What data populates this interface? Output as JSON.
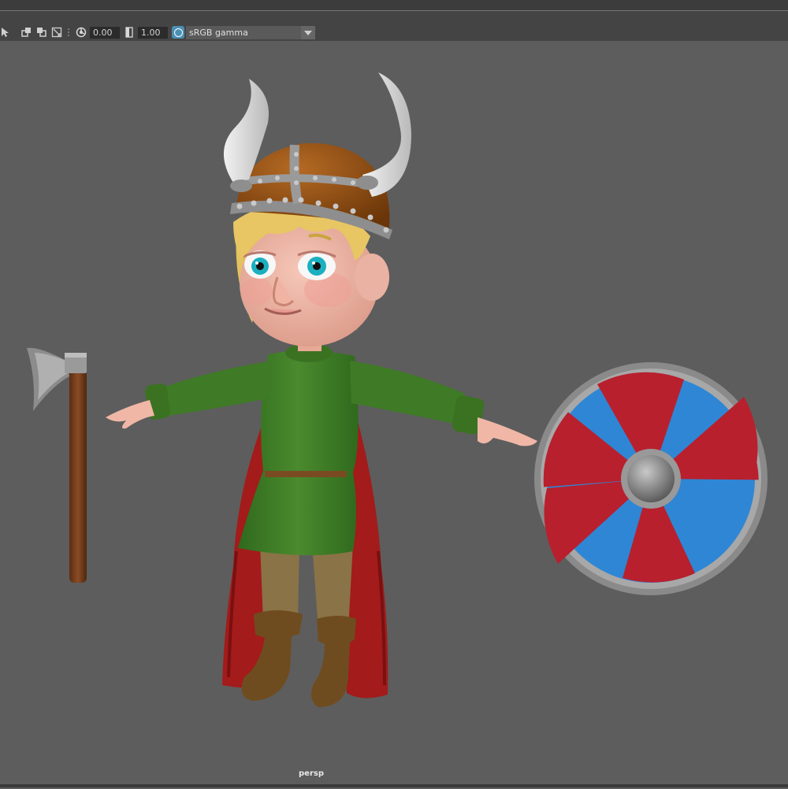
{
  "toolbar": {
    "exposure_value": "0.00",
    "gamma_value": "1.00",
    "view_transform": "sRGB gamma",
    "icons": [
      "select-camera-icon",
      "isolate-icon",
      "xray-icon",
      "wireframe-icon",
      "exposure-icon",
      "gamma-icon",
      "color-management-icon",
      "chevron-down-icon"
    ]
  },
  "viewport": {
    "camera_name": "persp",
    "background_color": "#5d5d5d",
    "scene_objects": [
      "viking-character",
      "battle-axe",
      "round-shield"
    ]
  },
  "colors": {
    "tunic": "#3f7a26",
    "cape": "#b01f1f",
    "shield_red": "#b8202e",
    "shield_blue": "#2f86d4",
    "helmet": "#8a4a14"
  }
}
